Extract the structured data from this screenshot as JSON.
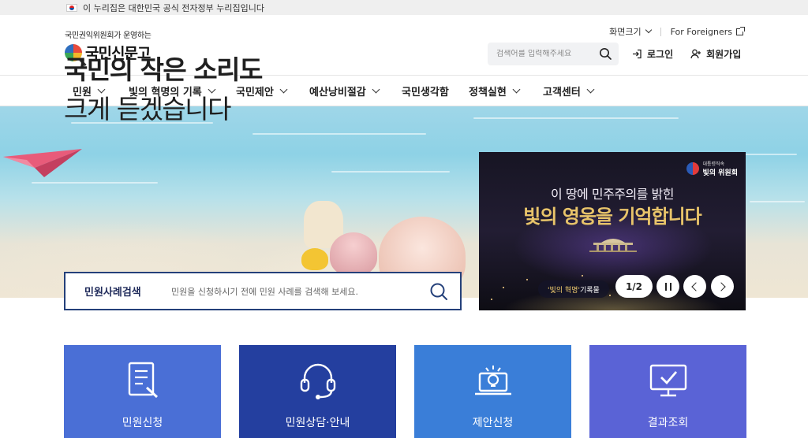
{
  "gov_banner": {
    "text": "이 누리집은 대한민국 공식 전자정부 누리집입니다"
  },
  "header": {
    "logo_sub": "국민권익위원회가 운영하는",
    "logo_main": "국민신문고",
    "screen_size": "화면크기",
    "foreigners": "For Foreigners",
    "search_placeholder": "검색어를 입력해주세요",
    "login": "로그인",
    "signup": "회원가입"
  },
  "nav": {
    "items": [
      {
        "label": "민원"
      },
      {
        "label": "빛의 혁명의 기록"
      },
      {
        "label": "국민제안"
      },
      {
        "label": "예산낭비절감"
      },
      {
        "label": "국민생각함"
      },
      {
        "label": "정책실현"
      },
      {
        "label": "고객센터"
      }
    ]
  },
  "hero": {
    "title_line1": "국민의 작은 소리도",
    "title_line2": "크게 듣겠습니다"
  },
  "case_search": {
    "label": "민원사례검색",
    "placeholder": "민원을 신청하시기 전에 민원 사례를 검색해 보세요."
  },
  "banner": {
    "org_small": "대통령직속",
    "org_name": "빛의 위원회",
    "line1": "이 땅에 민주주의를 밝힌",
    "line2": "빛의 영웅을 기억합니다",
    "tag_quote": "'빛의 혁명'",
    "tag_rest": " 기록물",
    "page_indicator": "1/2"
  },
  "services": [
    {
      "label": "민원신청",
      "icon": "document-pen-icon",
      "color": "#4a6fd6"
    },
    {
      "label": "민원상담·안내",
      "icon": "headset-icon",
      "color": "#243f9f"
    },
    {
      "label": "제안신청",
      "icon": "lightbulb-laptop-icon",
      "color": "#3a7ed8"
    },
    {
      "label": "결과조회",
      "icon": "monitor-check-icon",
      "color": "#5a63d6"
    }
  ]
}
